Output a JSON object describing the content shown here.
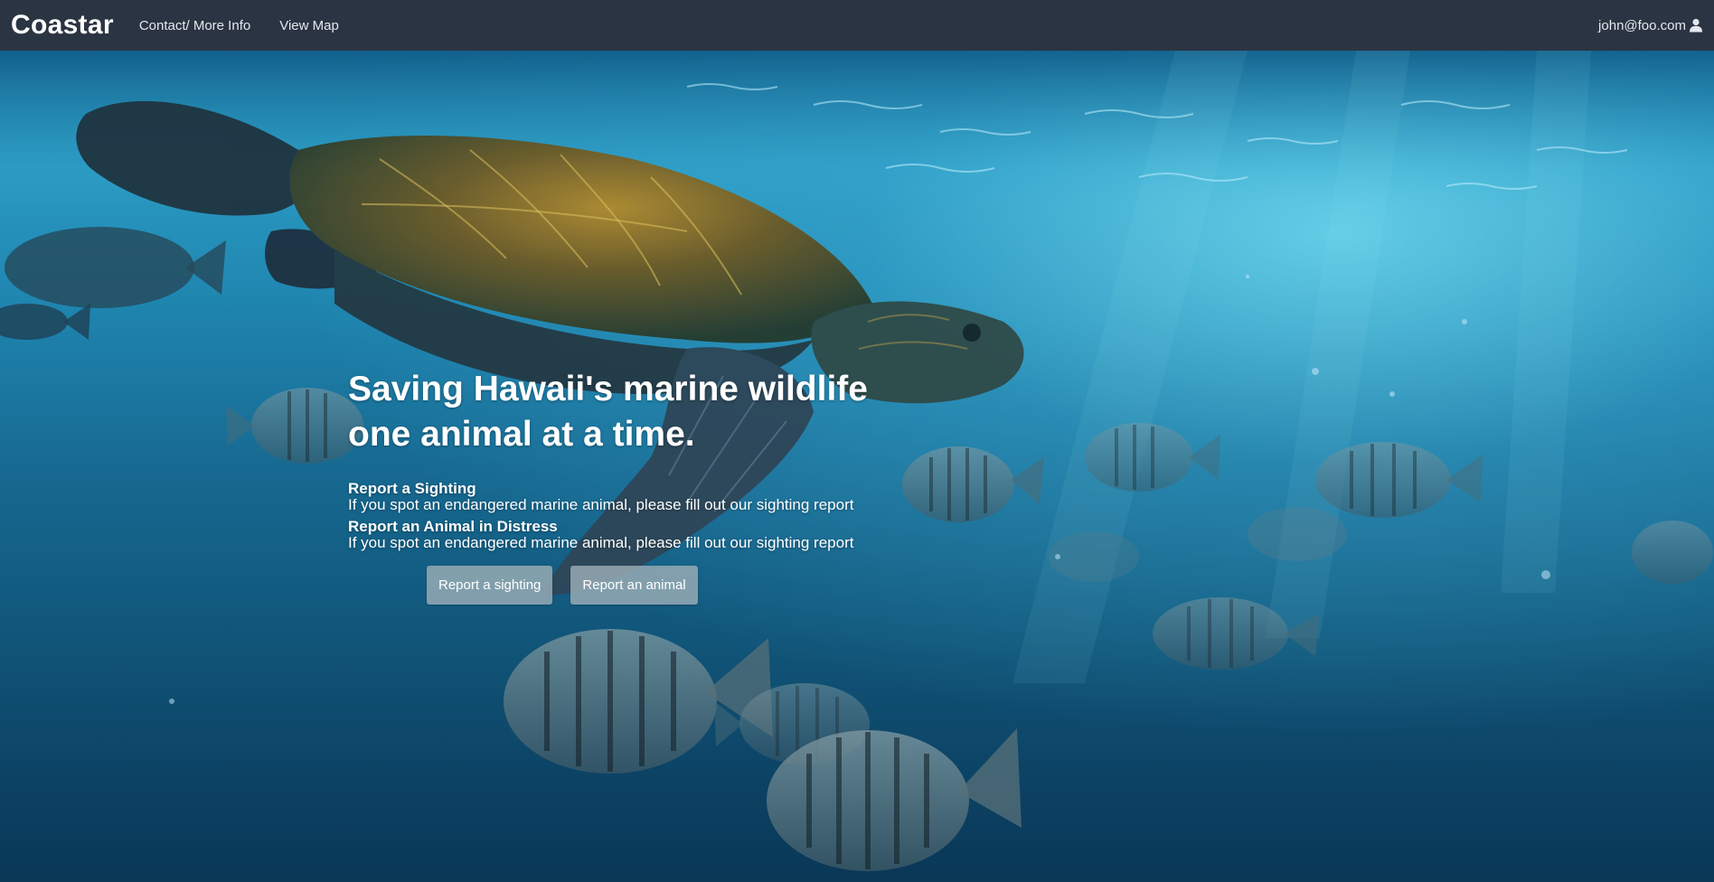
{
  "navbar": {
    "brand": "Coastar",
    "links": [
      "Contact/ More Info",
      "View Map"
    ],
    "user_email": "john@foo.com",
    "user_icon": "user-icon"
  },
  "hero": {
    "headline_line1": "Saving Hawaii's marine wildlife",
    "headline_line2": "one animal at a time.",
    "items": [
      {
        "title": "Report a Sighting",
        "description": "If you spot an endangered marine animal, please fill out our sighting report"
      },
      {
        "title": "Report an Animal in Distress",
        "description": "If you spot an endangered marine animal, please fill out our sighting report"
      }
    ],
    "buttons": {
      "sighting": "Report a sighting",
      "animal": "Report an animal"
    },
    "background_image": "underwater sea turtle with striped reef fish"
  },
  "colors": {
    "navbar": "#2b3442",
    "button": "#96aab4",
    "ocean_deep": "#0a3756",
    "ocean_light": "#2a9ac2"
  }
}
